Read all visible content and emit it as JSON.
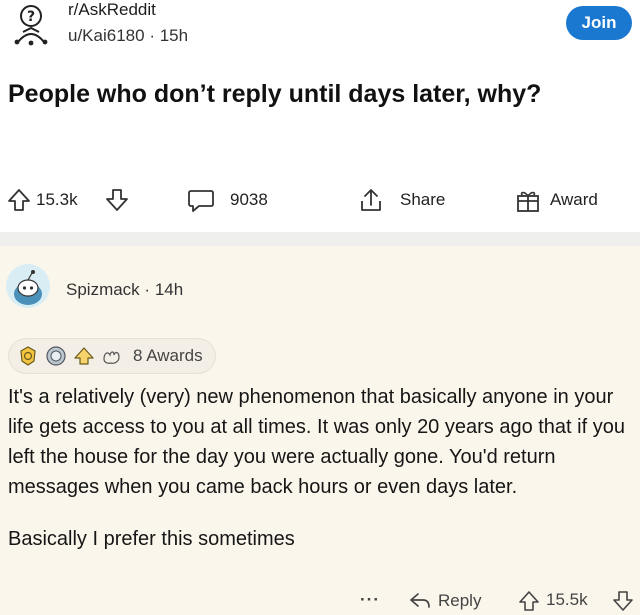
{
  "post": {
    "subreddit": "r/AskReddit",
    "author": "u/Kai6180",
    "separator": "·",
    "age": "15h",
    "join_label": "Join",
    "title": "People who don’t reply until days later, why?",
    "upvotes": "15.3k",
    "comments": "9038",
    "share_label": "Share",
    "award_label": "Award"
  },
  "comment": {
    "author": "Spizmack",
    "separator": "·",
    "age": "14h",
    "awards_label": "8 Awards",
    "paragraphs": [
      "It's a relatively (very) new phenomenon that basically anyone in your life gets access to you at all times. It was only 20 years ago that if you left the house for the day you were actually gone. You'd return messages when you came back hours or even days later.",
      "Basically I prefer this sometimes"
    ],
    "more_label": "···",
    "reply_label": "Reply",
    "upvotes": "15.5k"
  },
  "colors": {
    "join_button": "#1b78d0",
    "comment_background": "#fbf6ec",
    "divider": "#efefee"
  }
}
